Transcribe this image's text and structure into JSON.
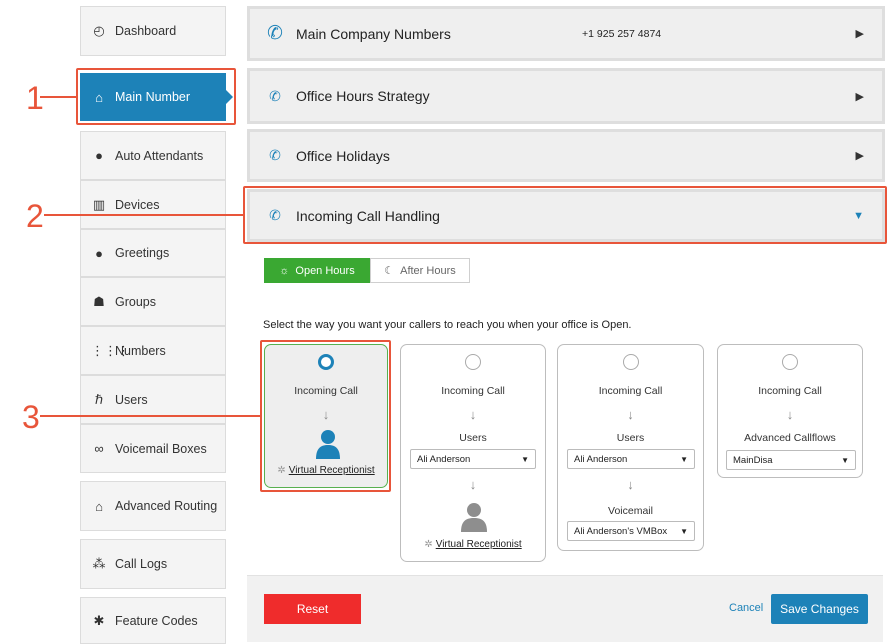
{
  "sidebar": {
    "items": [
      {
        "label": "Dashboard",
        "icon": "gauge-icon"
      },
      {
        "label": "Main Number",
        "icon": "home-icon",
        "active": true
      },
      {
        "label": "Auto Attendants",
        "icon": "speaker-head-icon"
      },
      {
        "label": "Devices",
        "icon": "fax-device-icon"
      },
      {
        "label": "Greetings",
        "icon": "speaker-head-icon"
      },
      {
        "label": "Groups",
        "icon": "group-icon"
      },
      {
        "label": "Numbers",
        "icon": "grid-icon"
      },
      {
        "label": "Users",
        "icon": "users-icon"
      },
      {
        "label": "Voicemail Boxes",
        "icon": "voicemail-icon"
      },
      {
        "label": "Advanced Routing",
        "icon": "home-icon"
      },
      {
        "label": "Call Logs",
        "icon": "call-logs-icon"
      },
      {
        "label": "Feature Codes",
        "icon": "asterisk-icon"
      }
    ]
  },
  "callouts": [
    "1",
    "2",
    "3"
  ],
  "accordion": [
    {
      "title": "Main Company Numbers",
      "value": "+1 925 257 4874",
      "expanded": false
    },
    {
      "title": "Office Hours Strategy",
      "expanded": false
    },
    {
      "title": "Office Holidays",
      "expanded": false
    },
    {
      "title": "Incoming Call Handling",
      "expanded": true
    }
  ],
  "tabs": {
    "open": "Open Hours",
    "after": "After Hours"
  },
  "instruction": "Select the way you want your callers to reach you when your office is Open.",
  "options": [
    {
      "selected": true,
      "line1": "Incoming Call",
      "link": "Virtual Receptionist"
    },
    {
      "selected": false,
      "line1": "Incoming Call",
      "line2": "Users",
      "select": "Ali Anderson",
      "link": "Virtual Receptionist"
    },
    {
      "selected": false,
      "line1": "Incoming Call",
      "line2": "Users",
      "select": "Ali Anderson",
      "line3": "Voicemail",
      "select2": "Ali Anderson's VMBox"
    },
    {
      "selected": false,
      "line1": "Incoming Call",
      "line2": "Advanced Callflows",
      "select": "MainDisa"
    }
  ],
  "footer": {
    "reset": "Reset",
    "cancel": "Cancel",
    "save": "Save Changes"
  },
  "colors": {
    "accent": "#1d82b8",
    "green": "#3aa832",
    "red": "#ef2c2c",
    "callout": "#e8553a"
  }
}
